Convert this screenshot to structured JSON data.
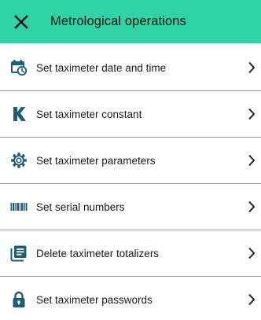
{
  "appbar": {
    "title": "Metrological operations",
    "close_icon": "close-icon",
    "color": "#2fd3a5"
  },
  "icon_color": "#1b5e7a",
  "items": [
    {
      "label": "Set taximeter date and time",
      "icon": "calendar-clock-icon"
    },
    {
      "label": "Set taximeter constant",
      "icon": "k-letter-icon"
    },
    {
      "label": "Set taximeter parameters",
      "icon": "gear-icon"
    },
    {
      "label": "Set serial numbers",
      "icon": "barcode-icon"
    },
    {
      "label": "Delete taximeter totalizers",
      "icon": "document-list-icon"
    },
    {
      "label": "Set taximeter passwords",
      "icon": "lock-icon"
    }
  ]
}
